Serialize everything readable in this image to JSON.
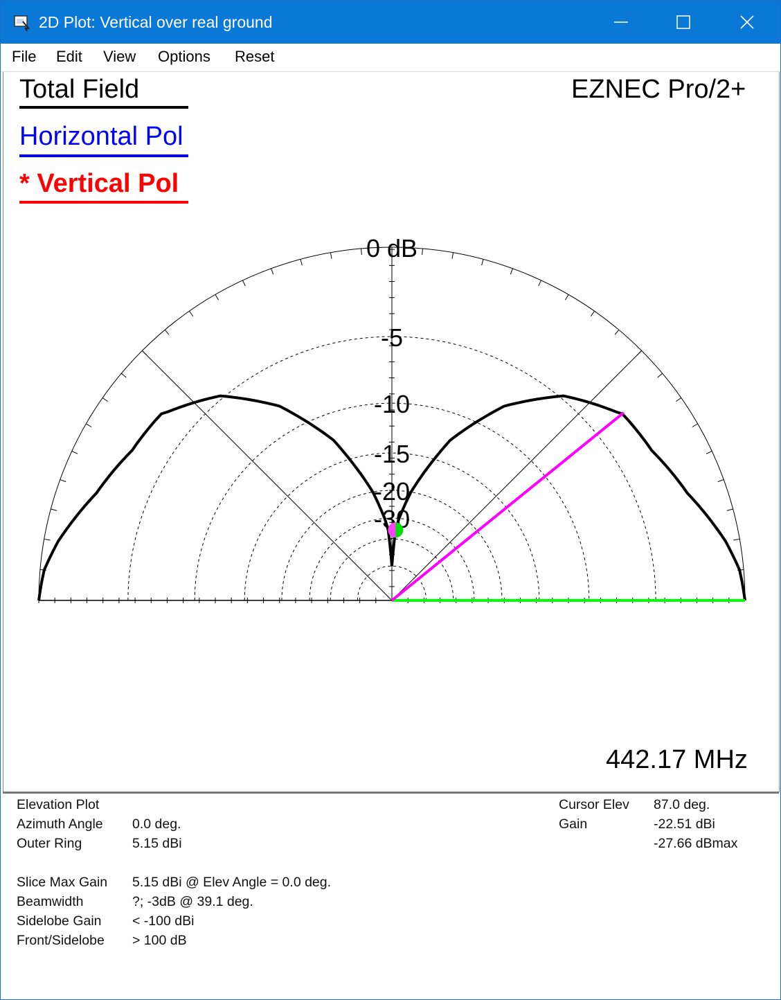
{
  "window": {
    "title": "2D Plot: Vertical over real ground",
    "icon": "eznec-app-icon",
    "controls": {
      "minimize": "minimize-icon",
      "maximize": "maximize-icon",
      "close": "close-icon"
    }
  },
  "menu": [
    "File",
    "Edit",
    "View",
    "Options",
    "Reset"
  ],
  "legend": {
    "total": {
      "label": "Total Field",
      "color": "#000000"
    },
    "horizontal": {
      "label": "Horizontal Pol",
      "color": "#0000ff"
    },
    "vertical": {
      "label": "* Vertical Pol",
      "color": "#ff0000"
    }
  },
  "program_name": "EZNEC Pro/2+",
  "frequency": "442.17 MHz",
  "chart_data": {
    "type": "line",
    "projection": "polar elevation (half circle, 0-180 deg)",
    "radial_ring_labels": [
      "0 dB",
      "-5",
      "-10",
      "-15",
      "-20",
      "-30"
    ],
    "radial_ring_values_db": [
      0,
      -5,
      -10,
      -15,
      -20,
      -25,
      -30,
      -40
    ],
    "radial_axis": "dB relative to outer ring (5.15 dBi)",
    "angular_axis": "elevation angle, deg",
    "series": [
      {
        "name": "Total Field",
        "color": "#000000",
        "pattern_description": "symmetric two-lobe elevation pattern, max at 0 deg elevation, null near 90 deg",
        "elev_deg": [
          0,
          5,
          10,
          20,
          30,
          39.1,
          40,
          50,
          60,
          70,
          80,
          85,
          87,
          90
        ],
        "gain_db_rel_max": [
          0,
          -0.2,
          -0.7,
          -2.0,
          -2.8,
          -3.0,
          -3.2,
          -4.8,
          -7.8,
          -12.5,
          -20.0,
          -25.0,
          -27.66,
          -40
        ]
      }
    ],
    "cursor": {
      "elev_deg": 87.0,
      "color": "#ff00ff"
    },
    "max_gain_line": {
      "elev_deg": 0.0,
      "color": "#00ff00"
    },
    "dashed_rings": true,
    "grid_lines_deg": [
      45,
      135
    ]
  },
  "info_left": [
    {
      "label": "Elevation Plot",
      "value": ""
    },
    {
      "label": "Azimuth Angle",
      "value": "0.0 deg."
    },
    {
      "label": "Outer Ring",
      "value": "5.15 dBi"
    },
    {
      "label": "",
      "value": ""
    },
    {
      "label": "Slice Max Gain",
      "value": "5.15 dBi @ Elev Angle = 0.0 deg."
    },
    {
      "label": "Beamwidth",
      "value": "?; -3dB @ 39.1 deg."
    },
    {
      "label": "Sidelobe Gain",
      "value": "< -100 dBi"
    },
    {
      "label": "Front/Sidelobe",
      "value": "> 100 dB"
    }
  ],
  "info_right": [
    {
      "label": "Cursor Elev",
      "value": "87.0 deg."
    },
    {
      "label": "Gain",
      "value": "-22.51 dBi"
    },
    {
      "label": "",
      "value": "-27.66 dBmax"
    }
  ]
}
